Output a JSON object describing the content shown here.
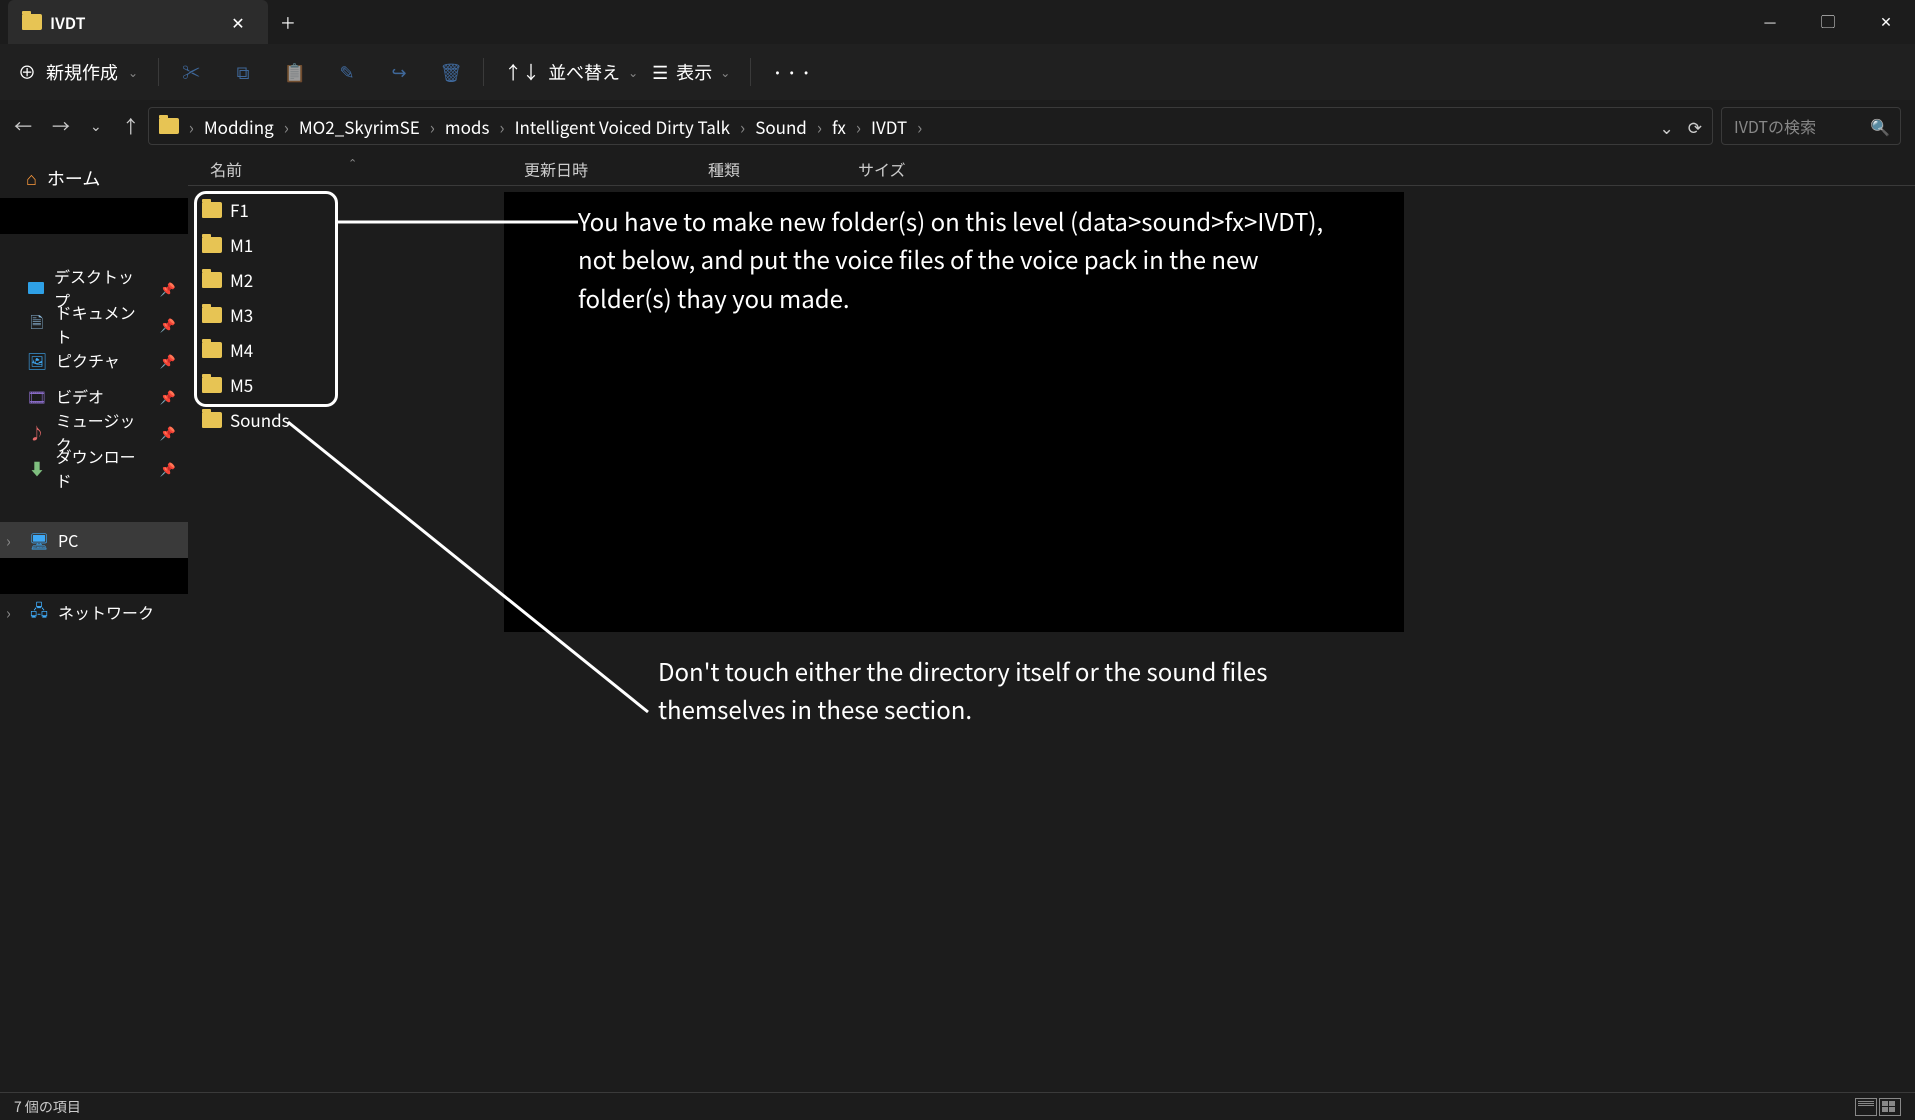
{
  "window": {
    "title": "IVDT"
  },
  "toolbar": {
    "new_label": "新規作成",
    "sort_label": "並べ替え",
    "view_label": "表示"
  },
  "breadcrumb": [
    "Modding",
    "MO2_SkyrimSE",
    "mods",
    "Intelligent Voiced Dirty Talk",
    "Sound",
    "fx",
    "IVDT"
  ],
  "search": {
    "placeholder": "IVDTの検索"
  },
  "sidebar": {
    "home": "ホーム",
    "quick": [
      {
        "label": "デスクトップ",
        "icon": "desktop"
      },
      {
        "label": "ドキュメント",
        "icon": "document"
      },
      {
        "label": "ピクチャ",
        "icon": "pictures"
      },
      {
        "label": "ビデオ",
        "icon": "videos"
      },
      {
        "label": "ミュージック",
        "icon": "music"
      },
      {
        "label": "ダウンロード",
        "icon": "downloads"
      }
    ],
    "pc": "PC",
    "network": "ネットワーク"
  },
  "columns": {
    "name": "名前",
    "date": "更新日時",
    "type": "種類",
    "size": "サイズ"
  },
  "items": [
    {
      "name": "F1"
    },
    {
      "name": "M1"
    },
    {
      "name": "M2"
    },
    {
      "name": "M3"
    },
    {
      "name": "M4"
    },
    {
      "name": "M5"
    },
    {
      "name": "Sounds"
    }
  ],
  "annotations": {
    "top": "You have to make new folder(s) on this level (data>sound>fx>IVDT), not below, and put the voice files of the voice pack in the new folder(s) thay you made.",
    "bottom": "Don't touch either the directory itself or the sound files themselves in these section."
  },
  "status": {
    "text": "7 個の項目"
  }
}
